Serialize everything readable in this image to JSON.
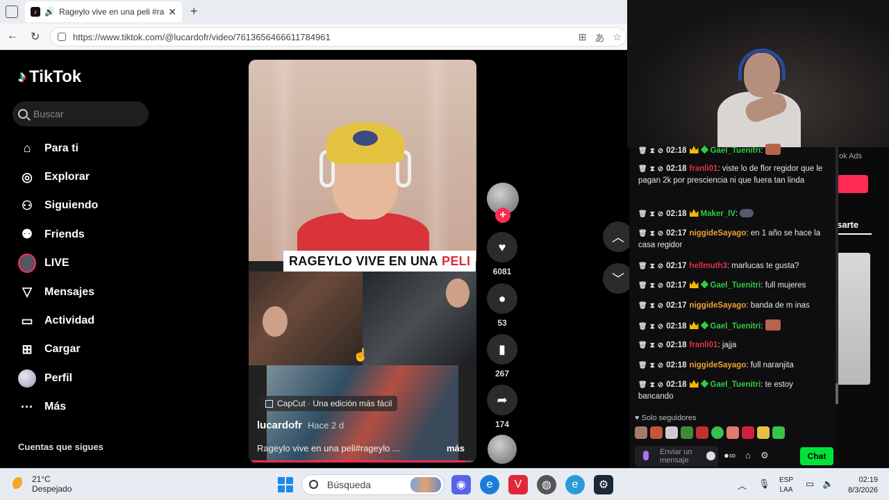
{
  "browser": {
    "tab_title": "Rageylo vive en una peli #rageylo",
    "tab_close": "✕",
    "new_tab": "+",
    "url": "https://www.tiktok.com/@lucardofr/video/7613656466611784961"
  },
  "tiktok": {
    "logo_text": "TikTok",
    "search_placeholder": "Buscar",
    "menu": [
      {
        "label": "Para ti",
        "icon": "home-icon"
      },
      {
        "label": "Explorar",
        "icon": "compass-icon"
      },
      {
        "label": "Siguiendo",
        "icon": "following-icon"
      },
      {
        "label": "Friends",
        "icon": "friends-icon"
      },
      {
        "label": "LIVE",
        "icon": "live-icon"
      },
      {
        "label": "Mensajes",
        "icon": "send-icon"
      },
      {
        "label": "Actividad",
        "icon": "activity-icon"
      },
      {
        "label": "Cargar",
        "icon": "upload-icon"
      },
      {
        "label": "Perfil",
        "icon": "profile-avatar"
      },
      {
        "label": "Más",
        "icon": "more-icon"
      }
    ],
    "following_accounts": "Cuentas que sigues",
    "video": {
      "overlay_title_black": "RAGEYLO VIVE EN UNA",
      "overlay_title_red": "PELI",
      "capcut_label": "CapCut · Una edición más fácil",
      "author": "lucardofr",
      "posted": "Hace 2 d",
      "description": "Rageylo vive en una peli#rageylo ...",
      "more_label": "más",
      "progress": 0.95
    },
    "actions": {
      "likes": "6081",
      "comments": "53",
      "saves": "267",
      "shares": "174"
    },
    "background_right": {
      "ads_text": "ok Ads",
      "tab_text": "sarte"
    }
  },
  "chat": {
    "messages": [
      {
        "time": "02:18",
        "user": "Gael_Tuenitri",
        "user_color": "#2ecc40",
        "badges": [
          "crown",
          "diamond"
        ],
        "text": "",
        "emote": true
      },
      {
        "time": "02:18",
        "user": "franli01",
        "user_color": "#e0304a",
        "badges": [],
        "text": "viste lo de flor regidor que le pagan 2k por presciencia ni que fuera tan linda"
      },
      {
        "time": "02:18",
        "user": "Maker_IV",
        "user_color": "#2ecc40",
        "badges": [
          "crown"
        ],
        "text": "",
        "emote2": true
      },
      {
        "time": "02:17",
        "user": "niggideSayago",
        "user_color": "#f0a030",
        "badges": [],
        "text": "en 1 año se hace la casa regidor"
      },
      {
        "time": "02:17",
        "user": "hellmuth3",
        "user_color": "#e0304a",
        "badges": [],
        "text": "marlucas te gusta?"
      },
      {
        "time": "02:17",
        "user": "Gael_Tuenitri",
        "user_color": "#2ecc40",
        "badges": [
          "crown",
          "diamond"
        ],
        "text": "full mujeres"
      },
      {
        "time": "02:17",
        "user": "niggideSayago",
        "user_color": "#f0a030",
        "badges": [],
        "text": "banda de m inas"
      },
      {
        "time": "02:18",
        "user": "Gael_Tuenitri",
        "user_color": "#2ecc40",
        "badges": [
          "crown",
          "diamond"
        ],
        "text": "",
        "emote": true
      },
      {
        "time": "02:18",
        "user": "franli01",
        "user_color": "#e0304a",
        "badges": [],
        "text": "jajja"
      },
      {
        "time": "02:18",
        "user": "niggideSayago",
        "user_color": "#f0a030",
        "badges": [],
        "text": "full naranjita"
      },
      {
        "time": "02:18",
        "user": "Gael_Tuenitri",
        "user_color": "#2ecc40",
        "badges": [
          "crown",
          "diamond"
        ],
        "text": "te estoy bancando"
      }
    ],
    "followers_only": "Solo seguidores",
    "input_placeholder": "Enviar un mensaje",
    "send_label": "Chat"
  },
  "taskbar": {
    "weather_temp": "21°C",
    "weather_desc": "Despejado",
    "search_placeholder": "Búsqueda",
    "lang_line1": "ESP",
    "lang_line2": "LAA",
    "time": "02:19",
    "date": "8/3/2026"
  },
  "colors": {
    "tiktok_red": "#fe2c55",
    "twitch_green": "#00e33a",
    "twitch_purple": "#a970ff"
  }
}
